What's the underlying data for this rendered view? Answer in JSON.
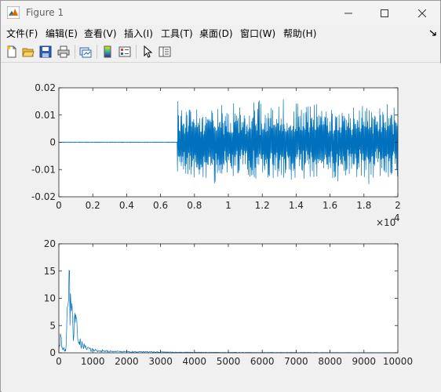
{
  "window": {
    "title": "Figure 1",
    "icons": {
      "app": "matlab-logo-icon",
      "minimize": "minimize-icon",
      "maximize": "maximize-icon",
      "close": "close-icon"
    }
  },
  "menu": {
    "items": [
      "文件(F)",
      "编辑(E)",
      "查看(V)",
      "插入(I)",
      "工具(T)",
      "桌面(D)",
      "窗口(W)",
      "帮助(H)"
    ],
    "dock_icon": "dock-arrow-icon"
  },
  "toolbar": {
    "buttons": [
      "new-figure-icon",
      "open-file-icon",
      "save-icon",
      "print-icon",
      "link-plot-icon",
      "insert-colorbar-icon",
      "insert-legend-icon",
      "edit-plot-icon",
      "property-inspector-icon"
    ]
  },
  "colors": {
    "line": "#0072bd",
    "axes_bg": "#ffffff",
    "figure_bg": "#f0f0f0"
  },
  "chart_data": [
    {
      "type": "line",
      "title": "",
      "xlabel": "",
      "ylabel": "",
      "xlim": [
        0,
        20000
      ],
      "ylim": [
        -0.02,
        0.02
      ],
      "x_ticks": [
        "0",
        "0.2",
        "0.4",
        "0.6",
        "0.8",
        "1",
        "1.2",
        "1.4",
        "1.6",
        "1.8",
        "2"
      ],
      "y_ticks": [
        "0.02",
        "0.01",
        "0",
        "-0.01",
        "-0.02"
      ],
      "x_exponent_base": "×10",
      "x_exponent_power": "4",
      "series": [
        {
          "description_segments": [
            {
              "x_range": [
                0,
                7000
              ],
              "amplitude": 0.0001
            },
            {
              "x_range": [
                7000,
                20000
              ],
              "amplitude": 0.016
            }
          ],
          "x": [
            0,
            2000,
            4000,
            6000,
            7000,
            7100,
            8000,
            9000,
            10000,
            11000,
            11500,
            12000,
            13000,
            14000,
            15000,
            16000,
            17000,
            18000,
            18400,
            19000,
            19500,
            20000
          ],
          "y": [
            0,
            0,
            0,
            0,
            0,
            0.008,
            -0.012,
            0.011,
            -0.012,
            0.013,
            -0.016,
            0.012,
            -0.013,
            0.012,
            -0.011,
            0.012,
            -0.011,
            0.013,
            -0.015,
            0.014,
            -0.012,
            0.01
          ]
        }
      ]
    },
    {
      "type": "line",
      "title": "",
      "xlabel": "",
      "ylabel": "",
      "xlim": [
        0,
        10000
      ],
      "ylim": [
        0,
        20
      ],
      "x_ticks": [
        "0",
        "1000",
        "2000",
        "3000",
        "4000",
        "5000",
        "6000",
        "7000",
        "8000",
        "9000",
        "10000"
      ],
      "y_ticks": [
        "20",
        "15",
        "10",
        "5",
        "0"
      ],
      "series": [
        {
          "x": [
            0,
            50,
            100,
            150,
            200,
            300,
            400,
            500,
            600,
            700,
            800,
            900,
            1000,
            1200,
            1500,
            2000,
            2500,
            3000,
            3500,
            4000,
            5000,
            6000,
            7000,
            8000,
            9000,
            10000
          ],
          "y": [
            0.5,
            4.5,
            2.0,
            1.0,
            0.5,
            19.0,
            8.0,
            7.5,
            3.0,
            2.0,
            1.5,
            1.0,
            0.8,
            0.6,
            0.4,
            0.3,
            0.25,
            0.2,
            0.15,
            0.12,
            0.1,
            0.08,
            0.07,
            0.06,
            0.05,
            0.05
          ]
        }
      ]
    }
  ]
}
